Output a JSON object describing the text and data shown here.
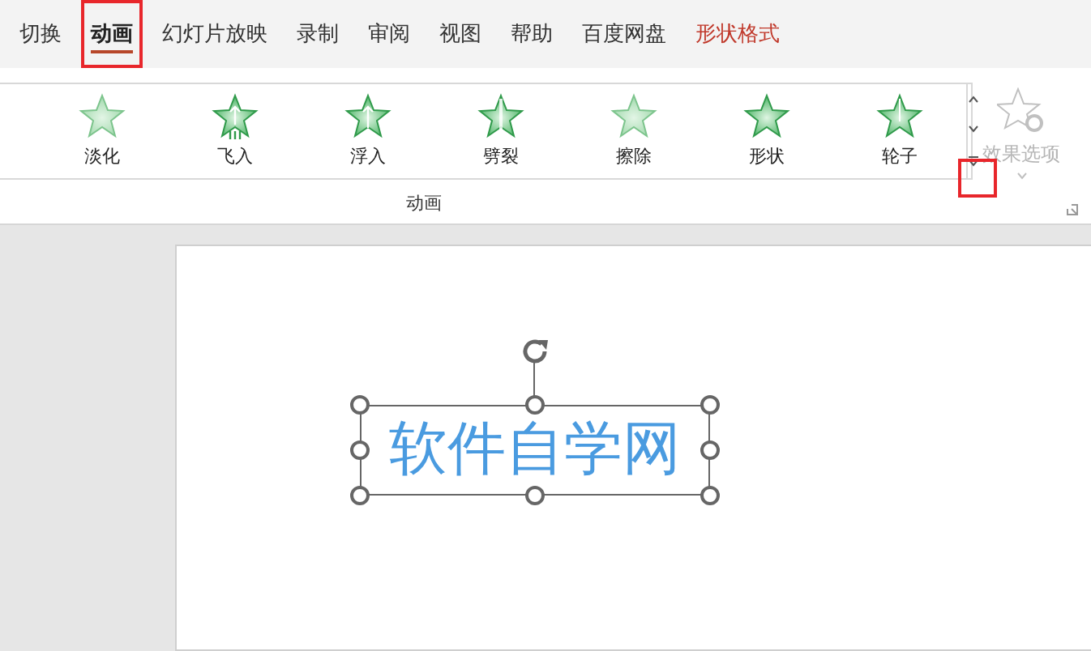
{
  "tabs": [
    {
      "label": "切换",
      "selected": false,
      "kind": "normal"
    },
    {
      "label": "动画",
      "selected": true,
      "kind": "normal"
    },
    {
      "label": "幻灯片放映",
      "selected": false,
      "kind": "normal"
    },
    {
      "label": "录制",
      "selected": false,
      "kind": "normal"
    },
    {
      "label": "审阅",
      "selected": false,
      "kind": "normal"
    },
    {
      "label": "视图",
      "selected": false,
      "kind": "normal"
    },
    {
      "label": "帮助",
      "selected": false,
      "kind": "normal"
    },
    {
      "label": "百度网盘",
      "selected": false,
      "kind": "normal"
    },
    {
      "label": "形状格式",
      "selected": false,
      "kind": "contextual"
    }
  ],
  "animations": [
    {
      "label": "淡化",
      "kind": "fade"
    },
    {
      "label": "飞入",
      "kind": "fly"
    },
    {
      "label": "浮入",
      "kind": "float"
    },
    {
      "label": "劈裂",
      "kind": "split"
    },
    {
      "label": "擦除",
      "kind": "wipe"
    },
    {
      "label": "形状",
      "kind": "shape"
    },
    {
      "label": "轮子",
      "kind": "wheel"
    }
  ],
  "effect_options": {
    "label": "效果选项",
    "disabled": true
  },
  "group_label": "动画",
  "slide": {
    "text_box": "软件自学网"
  }
}
